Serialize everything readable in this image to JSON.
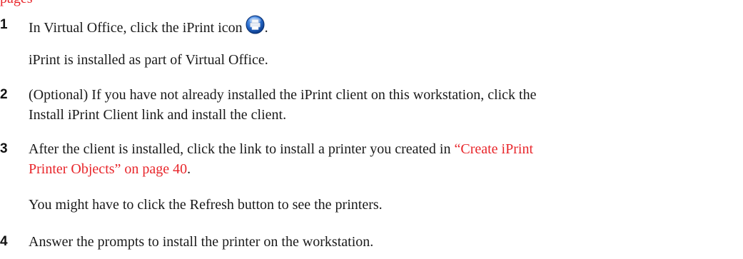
{
  "header_fragment": "pages",
  "steps": [
    {
      "number": "1",
      "text_before_icon": "In Virtual Office, click the iPrint icon",
      "text_after_icon": ".",
      "icon": "printer-icon",
      "note": "iPrint is installed as part of Virtual Office."
    },
    {
      "number": "2",
      "line1": "(Optional) If you have not already installed the iPrint client on this workstation, click the",
      "line2": "Install iPrint Client link and install the client."
    },
    {
      "number": "3",
      "line1_before_link": "After the client is installed, click the link to install a printer you created in ",
      "link_line1": "“Create iPrint",
      "link_line2": "Printer Objects” on page 40",
      "line2_after_link": ".",
      "note": "You might have to click the Refresh button to see the printers."
    },
    {
      "number": "4",
      "text": "Answer the prompts to install the printer on the workstation."
    }
  ],
  "colors": {
    "link": "#e8262b",
    "icon_blue": "#1f5fbf"
  }
}
